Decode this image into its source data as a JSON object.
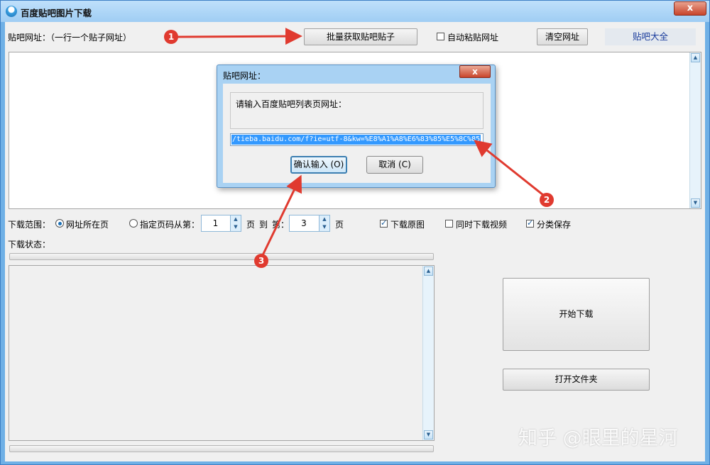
{
  "window": {
    "title": "百度贴吧图片下载",
    "close_symbol": "x"
  },
  "top": {
    "url_label": "贴吧网址：（一行一个贴子网址）",
    "batch_button": "批量获取贴吧贴子",
    "auto_paste_label": "自动粘贴网址",
    "auto_paste_checked": false,
    "clear_button": "清空网址",
    "tieba_link": "贴吧大全"
  },
  "dialog": {
    "title": "贴吧网址：",
    "close_symbol": "x",
    "prompt": "请输入百度贴吧列表页网址：",
    "url_value": "/tieba.baidu.com/f?ie=utf-8&kw=%E8%A1%A8%E6%83%85%E5%8C%85",
    "confirm_button": "确认输入 (O)",
    "cancel_button": "取消 (C)"
  },
  "options": {
    "range_label": "下载范围：",
    "radio_current": "网址所在页",
    "radio_current_selected": true,
    "radio_pages": "指定页码从第：",
    "page_from": "1",
    "page_unit": "页",
    "to_label": "到",
    "di_label": "第：",
    "page_to": "3",
    "page_unit2": "页",
    "download_original": "下载原图",
    "download_original_checked": true,
    "download_video": "同时下载视频",
    "download_video_checked": false,
    "category_save": "分类保存",
    "category_save_checked": true
  },
  "status": {
    "label": "下载状态："
  },
  "actions": {
    "start_button": "开始下载",
    "open_folder_button": "打开文件夹"
  },
  "annotations": {
    "marker1": "1",
    "marker2": "2",
    "marker3": "3"
  },
  "watermark": "知乎 @眼里的星河",
  "colors": {
    "arrow": "#e03a2f",
    "accent": "#3399ff",
    "title_bar": "#a9d2f3"
  },
  "icons": {
    "up": "scroll-up-icon",
    "down": "scroll-down-icon"
  }
}
